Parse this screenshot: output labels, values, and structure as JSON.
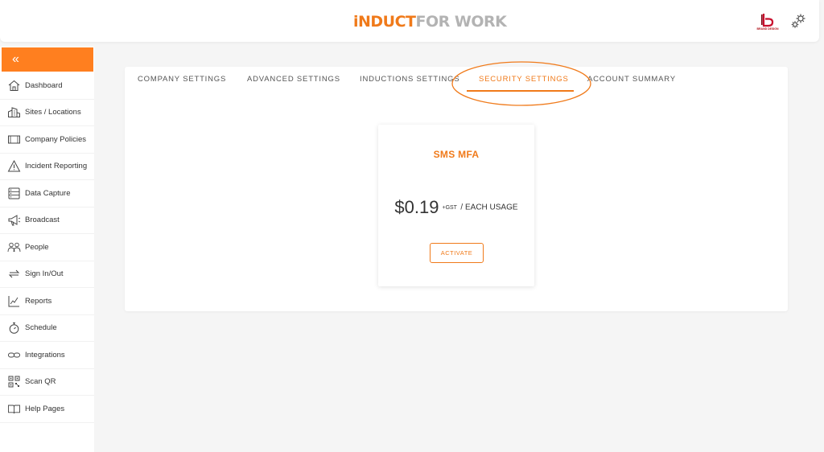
{
  "header": {
    "logo_part1": "iNDUCT",
    "logo_part2": "FOR WORK",
    "brand_caption": "BRAND DESIGN"
  },
  "sidebar": {
    "collapse_label": "«",
    "items": [
      {
        "label": "Dashboard",
        "icon": "home-icon"
      },
      {
        "label": "Sites / Locations",
        "icon": "buildings-icon"
      },
      {
        "label": "Company Policies",
        "icon": "document-icon"
      },
      {
        "label": "Incident Reporting",
        "icon": "warning-icon"
      },
      {
        "label": "Data Capture",
        "icon": "database-icon"
      },
      {
        "label": "Broadcast",
        "icon": "megaphone-icon"
      },
      {
        "label": "People",
        "icon": "people-icon"
      },
      {
        "label": "Sign In/Out",
        "icon": "arrows-icon"
      },
      {
        "label": "Reports",
        "icon": "chart-icon"
      },
      {
        "label": "Schedule",
        "icon": "stopwatch-icon"
      },
      {
        "label": "Integrations",
        "icon": "link-icon"
      },
      {
        "label": "Scan QR",
        "icon": "qr-icon"
      },
      {
        "label": "Help Pages",
        "icon": "book-icon"
      }
    ]
  },
  "tabs": [
    {
      "label": "COMPANY SETTINGS",
      "active": false
    },
    {
      "label": "ADVANCED SETTINGS",
      "active": false
    },
    {
      "label": "INDUCTIONS SETTINGS",
      "active": false
    },
    {
      "label": "SECURITY SETTINGS",
      "active": true
    },
    {
      "label": "ACCOUNT SUMMARY",
      "active": false
    }
  ],
  "card": {
    "title": "SMS MFA",
    "price": "$0.19",
    "gst": "+GST",
    "suffix": "/ EACH USAGE",
    "button_label": "ACTIVATE"
  },
  "colors": {
    "accent": "#f07a1a",
    "sidebar_toggle": "#ff7f1f",
    "background": "#f5f5f5"
  }
}
